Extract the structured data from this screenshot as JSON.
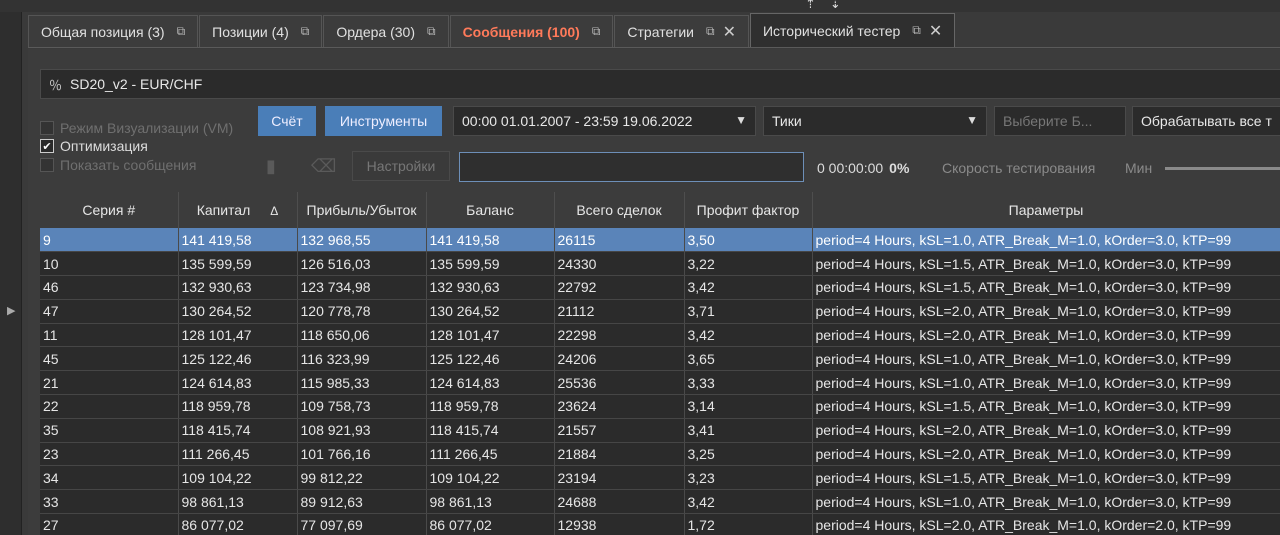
{
  "tabs": [
    {
      "label": "Общая позиция (3)",
      "active": false,
      "alert": false,
      "closable": false
    },
    {
      "label": "Позиции (4)",
      "active": false,
      "alert": false,
      "closable": false
    },
    {
      "label": "Ордера (30)",
      "active": false,
      "alert": false,
      "closable": false
    },
    {
      "label": "Сообщения (100)",
      "active": false,
      "alert": true,
      "closable": false
    },
    {
      "label": "Стратегии",
      "active": false,
      "alert": false,
      "closable": true
    },
    {
      "label": "Исторический тестер",
      "active": true,
      "alert": false,
      "closable": true
    }
  ],
  "strategy": {
    "label": "SD20_v2  -  EUR/CHF",
    "icon": "percent-icon"
  },
  "options": {
    "visualization": "Режим Визуализации (VM)",
    "optimization": "Оптимизация",
    "show_messages": "Показать сообщения",
    "optimization_checked": true
  },
  "buttons": {
    "account": "Счёт",
    "instruments": "Инструменты",
    "settings": "Настройки"
  },
  "fields": {
    "date_range": "00:00 01.01.2007 - 23:59 19.06.2022",
    "data_type": "Тики",
    "select_placeholder": "Выберите Б...",
    "process": "Обрабатывать все т"
  },
  "status": {
    "timer": "0 00:00:00",
    "percent": "0%",
    "speed_label": "Скорость тестирования",
    "speed_min": "Мин"
  },
  "table": {
    "headers": [
      "Серия #",
      "Капитал",
      "Прибыль/Убыток",
      "Баланс",
      "Всего сделок",
      "Профит фактор",
      "Параметры"
    ],
    "sort_mark": "Δ",
    "selected_index": 0,
    "rows": [
      [
        "9",
        "141 419,58",
        "132 968,55",
        "141 419,58",
        "26115",
        "3,50",
        "period=4 Hours, kSL=1.0, ATR_Break_M=1.0, kOrder=3.0, kTP=99"
      ],
      [
        "10",
        "135 599,59",
        "126 516,03",
        "135 599,59",
        "24330",
        "3,22",
        "period=4 Hours, kSL=1.5, ATR_Break_M=1.0, kOrder=3.0, kTP=99"
      ],
      [
        "46",
        "132 930,63",
        "123 734,98",
        "132 930,63",
        "22792",
        "3,42",
        "period=4 Hours, kSL=1.5, ATR_Break_M=1.0, kOrder=3.0, kTP=99"
      ],
      [
        "47",
        "130 264,52",
        "120 778,78",
        "130 264,52",
        "21112",
        "3,71",
        "period=4 Hours, kSL=2.0, ATR_Break_M=1.0, kOrder=3.0, kTP=99"
      ],
      [
        "11",
        "128 101,47",
        "118 650,06",
        "128 101,47",
        "22298",
        "3,42",
        "period=4 Hours, kSL=2.0, ATR_Break_M=1.0, kOrder=3.0, kTP=99"
      ],
      [
        "45",
        "125 122,46",
        "116 323,99",
        "125 122,46",
        "24206",
        "3,65",
        "period=4 Hours, kSL=1.0, ATR_Break_M=1.0, kOrder=3.0, kTP=99"
      ],
      [
        "21",
        "124 614,83",
        "115 985,33",
        "124 614,83",
        "25536",
        "3,33",
        "period=4 Hours, kSL=1.0, ATR_Break_M=1.0, kOrder=3.0, kTP=99"
      ],
      [
        "22",
        "118 959,78",
        "109 758,73",
        "118 959,78",
        "23624",
        "3,14",
        "period=4 Hours, kSL=1.5, ATR_Break_M=1.0, kOrder=3.0, kTP=99"
      ],
      [
        "35",
        "118 415,74",
        "108 921,93",
        "118 415,74",
        "21557",
        "3,41",
        "period=4 Hours, kSL=2.0, ATR_Break_M=1.0, kOrder=3.0, kTP=99"
      ],
      [
        "23",
        "111 266,45",
        "101 766,16",
        "111 266,45",
        "21884",
        "3,25",
        "period=4 Hours, kSL=2.0, ATR_Break_M=1.0, kOrder=3.0, kTP=99"
      ],
      [
        "34",
        "109 104,22",
        "99 812,22",
        "109 104,22",
        "23194",
        "3,23",
        "period=4 Hours, kSL=1.5, ATR_Break_M=1.0, kOrder=3.0, kTP=99"
      ],
      [
        "33",
        "98 861,13",
        "89 912,63",
        "98 861,13",
        "24688",
        "3,42",
        "period=4 Hours, kSL=1.0, ATR_Break_M=1.0, kOrder=3.0, kTP=99"
      ],
      [
        "27",
        "86 077,02",
        "77 097,69",
        "86 077,02",
        "12938",
        "1,72",
        "period=4 Hours, kSL=2.0, ATR_Break_M=1.0, kOrder=2.0, kTP=99"
      ]
    ]
  },
  "colors": {
    "accent": "#4a7eb8",
    "selected_row": "#5a84b9",
    "alert_tab": "#ff7a5a"
  }
}
